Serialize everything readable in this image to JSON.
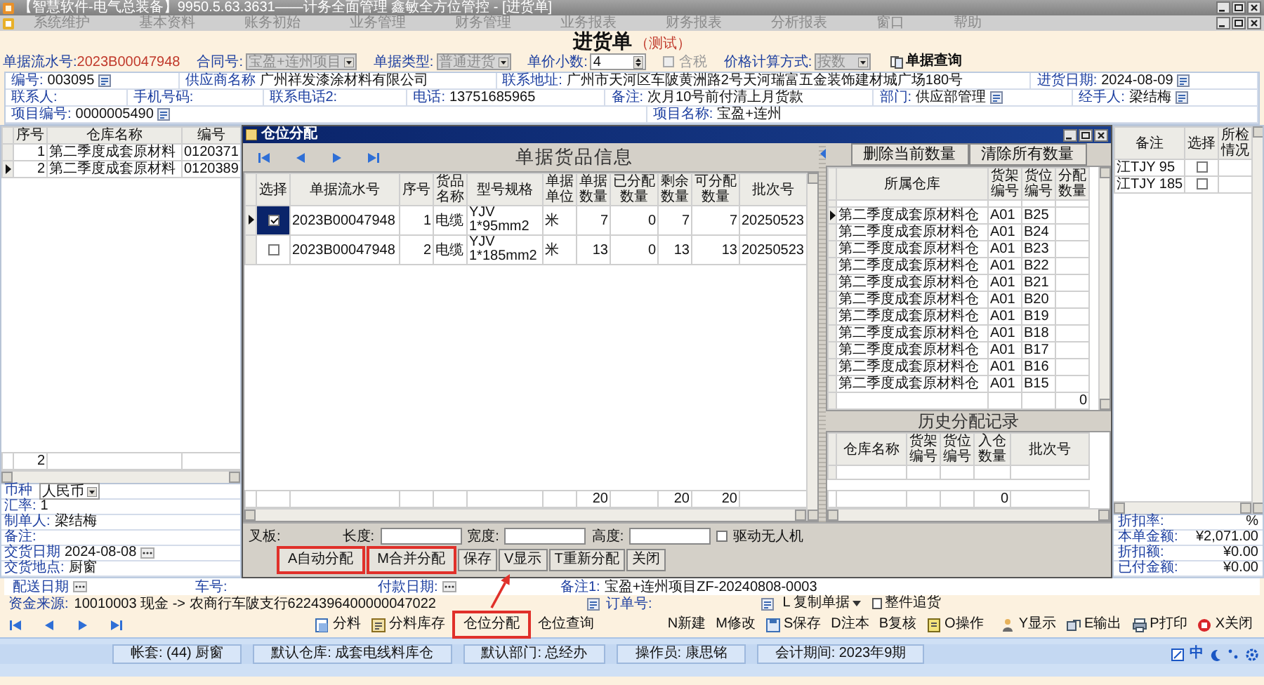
{
  "window": {
    "title": "【智慧软件-电气总装备】9950.5.63.3631——计务全面管理 鑫敏全方位管控 - [进货单]"
  },
  "menu": [
    "系统维护",
    "基本资料",
    "账务初始",
    "业务管理",
    "财务管理",
    "业务报表",
    "财务报表",
    "分析报表",
    "窗口",
    "帮助"
  ],
  "heading": {
    "title": "进货单",
    "subtitle": "（测试）"
  },
  "header_fields": [
    {
      "kind": "serial",
      "label": "单据流水号:",
      "value": "2023B00047948",
      "disabled": false
    },
    {
      "kind": "select",
      "label": "合同号:",
      "value": "宝盈+连州项目",
      "disabled": true
    },
    {
      "kind": "select",
      "label": "单据类型:",
      "value": "普通进货",
      "disabled": true
    },
    {
      "kind": "spin",
      "label": "单价小数:",
      "value": "4",
      "disabled": false
    },
    {
      "kind": "check",
      "label": "含税",
      "checked": false,
      "disabled": true
    },
    {
      "kind": "select",
      "label": "价格计算方式:",
      "value": "按数",
      "disabled": true
    },
    {
      "kind": "button",
      "label": "单据查询",
      "disabled": false
    }
  ],
  "form_rows": [
    [
      {
        "label": "编号:",
        "value": "003095",
        "lookup": true
      },
      {
        "label": "供应商名称",
        "value": "广州祥发漆涂材料有限公司",
        "lookup": false
      },
      {
        "label": "联系地址:",
        "value": "广州市天河区车陂黄洲路2号天河瑞富五金装饰建材城广场180号",
        "lookup": false
      },
      {
        "label": "进货日期:",
        "value": "2024-08-09",
        "lookup": true
      }
    ],
    [
      {
        "label": "联系人:",
        "lookup": false
      },
      {
        "label": "手机号码:",
        "lookup": false
      },
      {
        "label": "联系电话2:",
        "lookup": false
      },
      {
        "label": "电话:",
        "value": "13751685965",
        "lookup": false
      },
      {
        "label": "备注:",
        "value": "次月10号前付清上月货款",
        "lookup": false
      },
      {
        "label": "部门:",
        "value": "供应部管理",
        "lookup": true
      },
      {
        "label": "经手人:",
        "value": "梁结梅",
        "lookup": true
      }
    ],
    [
      {
        "label": "项目编号:",
        "value": "0000005490",
        "lookup": true
      },
      {
        "label": "项目名称:",
        "value": "宝盈+连州",
        "lookup": false
      }
    ]
  ],
  "main_grid": {
    "columns_left": [
      "序号",
      "仓库名称",
      "编号"
    ],
    "columns_right": [
      "备注",
      "选择",
      "所检情况"
    ],
    "rows": [
      {
        "current": false,
        "cells": [
          "1",
          "第二季度成套原材料",
          "0120371"
        ],
        "note": "江TJY 95",
        "checked": false
      },
      {
        "current": true,
        "cells": [
          "2",
          "第二季度成套原材料",
          "0120389"
        ],
        "note": "江TJY 185",
        "checked": false
      }
    ],
    "count": "2"
  },
  "summary_left": [
    {
      "kind": "select",
      "label": "币种",
      "value": "人民币"
    },
    {
      "kind": "text",
      "label": "汇率:",
      "value": "1"
    },
    {
      "kind": "text",
      "label": "制单人:",
      "value": "梁结梅"
    },
    {
      "kind": "text",
      "label": "备注:"
    },
    {
      "kind": "date",
      "label": "交货日期",
      "value": "2024-08-08"
    },
    {
      "kind": "text",
      "label": "交货地点:",
      "value": "厨窗"
    }
  ],
  "summary_right": [
    {
      "label": "折扣率:",
      "value": "%"
    },
    {
      "label": "本单金额:",
      "value": "¥2,071.00"
    },
    {
      "label": "折扣额:",
      "value": "¥0.00"
    },
    {
      "label": "已付金额:",
      "value": "¥0.00"
    }
  ],
  "delivery_row": [
    {
      "kind": "date",
      "label": "配送日期"
    },
    {
      "kind": "text",
      "label": "车号:"
    },
    {
      "kind": "date",
      "label": "付款日期:"
    },
    {
      "kind": "text",
      "label": "备注1:",
      "value": "宝盈+连州项目ZF-20240808-0003"
    }
  ],
  "funds": {
    "label": "资金来源:",
    "value": "10010003 现金 -> 农商行车陂支行6224396400000047022",
    "order_label": "订单号:",
    "actions": [
      {
        "label": "L 复制单据",
        "dropdown": true
      },
      {
        "label": "整件追货",
        "dropdown": false
      }
    ]
  },
  "toolbar": {
    "left": [
      {
        "label": "分料",
        "highlighted": false
      },
      {
        "label": "分料库存",
        "highlighted": false
      },
      {
        "label": "仓位分配",
        "highlighted": true
      },
      {
        "label": "仓位查询",
        "highlighted": false
      }
    ],
    "middle": [
      {
        "label": "N新建",
        "highlighted": false
      },
      {
        "label": "M修改",
        "highlighted": false
      },
      {
        "label": "S保存",
        "highlighted": false
      },
      {
        "label": "D注本",
        "highlighted": false
      },
      {
        "label": "B复核",
        "highlighted": false
      },
      {
        "label": "O操作",
        "highlighted": false
      }
    ],
    "right": [
      {
        "label": "Y显示",
        "highlighted": false
      },
      {
        "label": "E输出",
        "highlighted": false
      },
      {
        "label": "P打印",
        "highlighted": false
      },
      {
        "label": "X关闭",
        "highlighted": false
      }
    ]
  },
  "status_bar": [
    "帐套: (44) 厨窗",
    "默认仓库: 成套电线料库仓",
    "默认部门: 总经办",
    "操作员: 康思铭",
    "会计期间: 2023年9期"
  ],
  "tray": {
    "ime": "中"
  },
  "dialog": {
    "title": "仓位分配",
    "goods": {
      "title": "单据货品信息",
      "select_label": "选择",
      "columns": [
        {
          "label": "单据流水号"
        },
        {
          "label": "序号"
        },
        {
          "label": "货品名称"
        },
        {
          "label": "型号规格"
        },
        {
          "label": "单据单位"
        },
        {
          "label": "单据数量",
          "total": "20"
        },
        {
          "label": "已分配数量"
        },
        {
          "label": "剩余数量",
          "total": "20"
        },
        {
          "label": "可分配数量",
          "total": "20"
        },
        {
          "label": "批次号"
        }
      ],
      "rows": [
        {
          "current": true,
          "selected": true,
          "cells": [
            "2023B00047948",
            "1",
            "电缆",
            "YJV 1*95mm2",
            "米",
            "7",
            "0",
            "7",
            "7",
            "20250523"
          ]
        },
        {
          "current": false,
          "selected": false,
          "cells": [
            "2023B00047948",
            "2",
            "电缆",
            "YJV 1*185mm2",
            "米",
            "13",
            "0",
            "13",
            "13",
            "20250523"
          ]
        }
      ]
    },
    "locations": {
      "buttons": [
        "删除当前数量",
        "清除所有数量"
      ],
      "columns": [
        {
          "label": "所属仓库"
        },
        {
          "label": "货架编号"
        },
        {
          "label": "货位编号"
        },
        {
          "label": "分配数量",
          "total": "0"
        }
      ],
      "rows": [
        {
          "current": true,
          "cells": [
            "第二季度成套原材料仓",
            "A01",
            "B25"
          ]
        },
        {
          "current": false,
          "cells": [
            "第二季度成套原材料仓",
            "A01",
            "B24"
          ]
        },
        {
          "current": false,
          "cells": [
            "第二季度成套原材料仓",
            "A01",
            "B23"
          ]
        },
        {
          "current": false,
          "cells": [
            "第二季度成套原材料仓",
            "A01",
            "B22"
          ]
        },
        {
          "current": false,
          "cells": [
            "第二季度成套原材料仓",
            "A01",
            "B21"
          ]
        },
        {
          "current": false,
          "cells": [
            "第二季度成套原材料仓",
            "A01",
            "B20"
          ]
        },
        {
          "current": false,
          "cells": [
            "第二季度成套原材料仓",
            "A01",
            "B19"
          ]
        },
        {
          "current": false,
          "cells": [
            "第二季度成套原材料仓",
            "A01",
            "B18"
          ]
        },
        {
          "current": false,
          "cells": [
            "第二季度成套原材料仓",
            "A01",
            "B17"
          ]
        },
        {
          "current": false,
          "cells": [
            "第二季度成套原材料仓",
            "A01",
            "B16"
          ]
        },
        {
          "current": false,
          "cells": [
            "第二季度成套原材料仓",
            "A01",
            "B15"
          ]
        }
      ]
    },
    "history": {
      "title": "历史分配记录",
      "columns": [
        {
          "label": "仓库名称"
        },
        {
          "label": "货架编号"
        },
        {
          "label": "货位编号"
        },
        {
          "label": "入仓数量",
          "total": "0"
        },
        {
          "label": "批次号"
        }
      ]
    },
    "pallet": {
      "label": "叉板:",
      "fields": [
        "长度:",
        "宽度:",
        "高度:"
      ],
      "drone": {
        "label": "驱动无人机",
        "checked": false
      }
    },
    "buttons": [
      {
        "label": "A自动分配",
        "highlighted": true
      },
      {
        "label": "M合并分配",
        "highlighted": true
      },
      {
        "label": "保存",
        "highlighted": false
      },
      {
        "label": "V显示",
        "highlighted": false
      },
      {
        "label": "T重新分配",
        "highlighted": false
      },
      {
        "label": "关闭",
        "highlighted": false
      }
    ]
  },
  "annotation_arrow": true
}
